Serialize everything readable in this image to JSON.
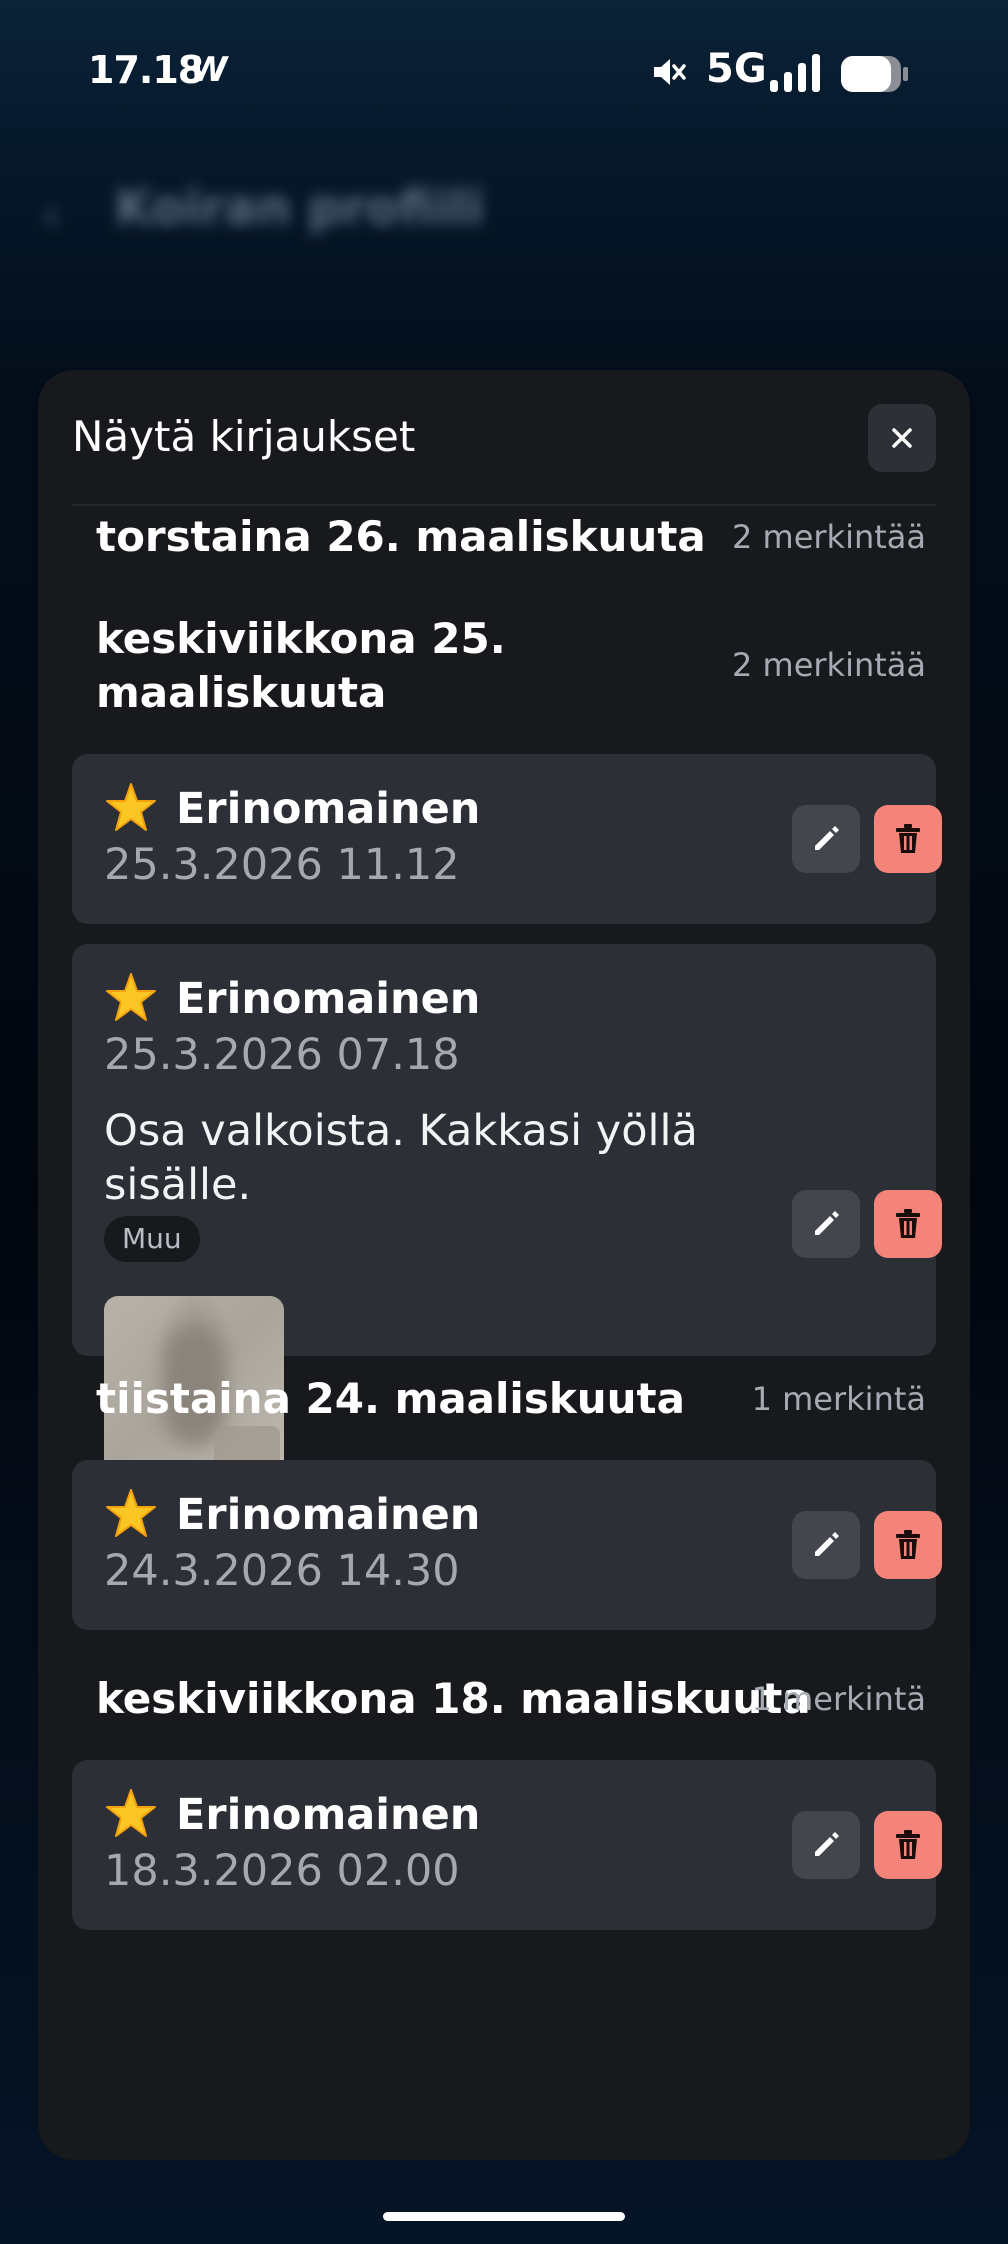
{
  "status_bar": {
    "time": "17.18",
    "app_icon_glyph": "W",
    "network": "5G",
    "icons": [
      "mute-icon",
      "signal-icon",
      "battery-icon"
    ]
  },
  "background_app": {
    "back_glyph": "‹",
    "title": "Koiran profiili"
  },
  "sheet": {
    "title": "Näytä kirjaukset",
    "close_glyph": "✕",
    "groups": [
      {
        "date": "torstaina 26. maaliskuuta",
        "count": "2 merkintää"
      },
      {
        "date": "keskiviikkona 25. maaliskuuta",
        "count": "2 merkintää"
      },
      {
        "date": "tiistaina 24. maaliskuuta",
        "count": "1 merkintä"
      },
      {
        "date": "keskiviikkona 18. maaliskuuta",
        "count": "1 merkintä"
      }
    ],
    "entries": [
      {
        "rating": "Erinomainen",
        "timestamp": "25.3.2026 11.12"
      },
      {
        "rating": "Erinomainen",
        "timestamp": "25.3.2026 07.18",
        "note": "Osa valkoista. Kakkasi yöllä sisälle.",
        "tag": "Muu",
        "photo": "blurred-photo-thumbnail"
      },
      {
        "rating": "Erinomainen",
        "timestamp": "24.3.2026 14.30"
      },
      {
        "rating": "Erinomainen",
        "timestamp": "18.3.2026 02.00"
      }
    ]
  },
  "colors": {
    "sheet_bg": "#17191d",
    "card_bg": "#2c2f35",
    "delete_accent": "#f4837a",
    "edit_bg": "#43464c",
    "muted_text": "#a3a8b1",
    "star": "#f9c623"
  }
}
